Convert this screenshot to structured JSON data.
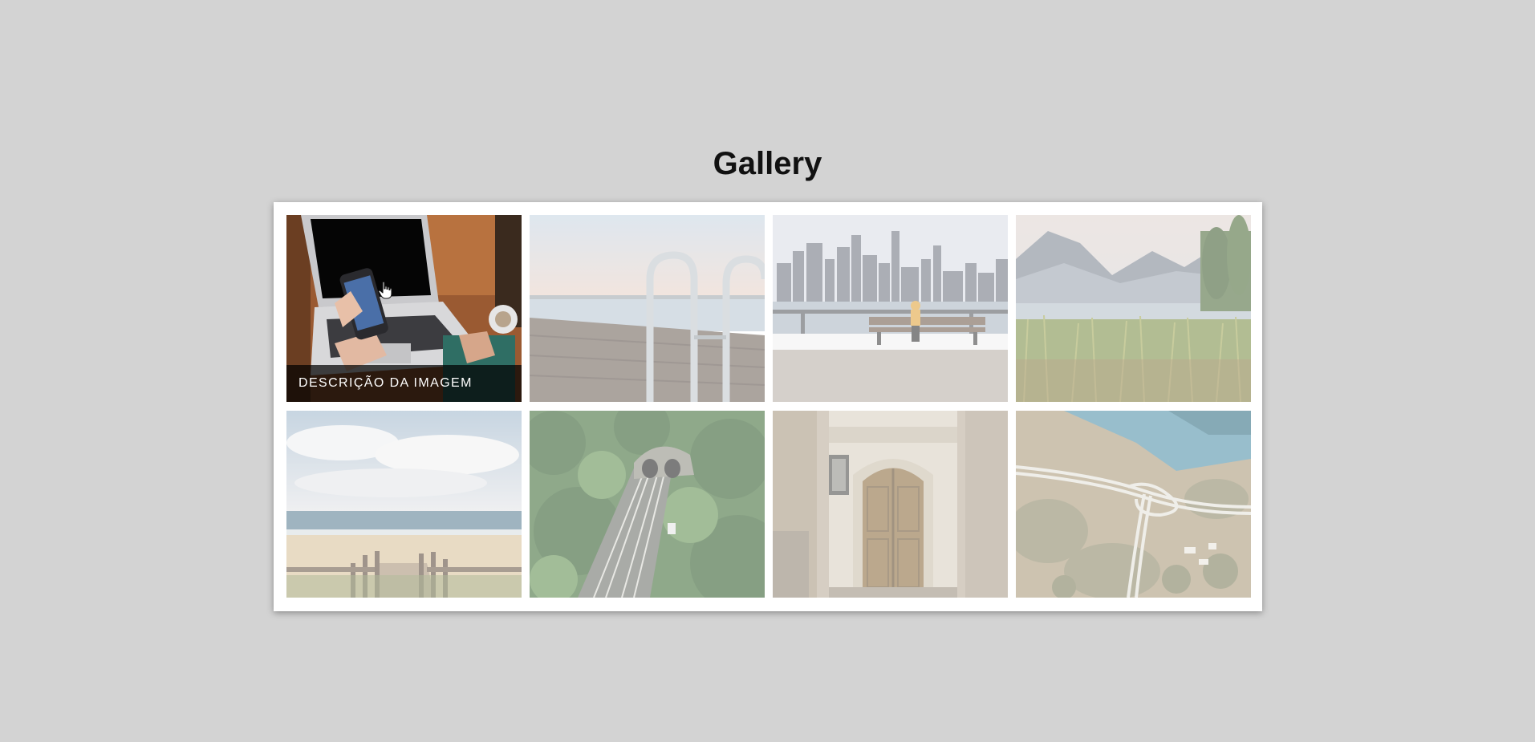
{
  "page": {
    "title": "Gallery"
  },
  "gallery": {
    "active_index": 0,
    "items": [
      {
        "icon": "laptop-phone-photo",
        "caption": "DESCRIÇÃO DA IMAGEM"
      },
      {
        "icon": "pier-ladder-photo"
      },
      {
        "icon": "city-skyline-bench-photo"
      },
      {
        "icon": "lake-mountains-reeds-photo"
      },
      {
        "icon": "beach-boardwalk-photo"
      },
      {
        "icon": "forest-railway-tunnel-photo"
      },
      {
        "icon": "wooden-door-photo"
      },
      {
        "icon": "aerial-highway-coast-photo"
      }
    ]
  },
  "colors": {
    "background": "#d3d3d3",
    "frame": "#ffffff",
    "caption_bg": "#000000b8",
    "caption_text": "#ffffff"
  }
}
